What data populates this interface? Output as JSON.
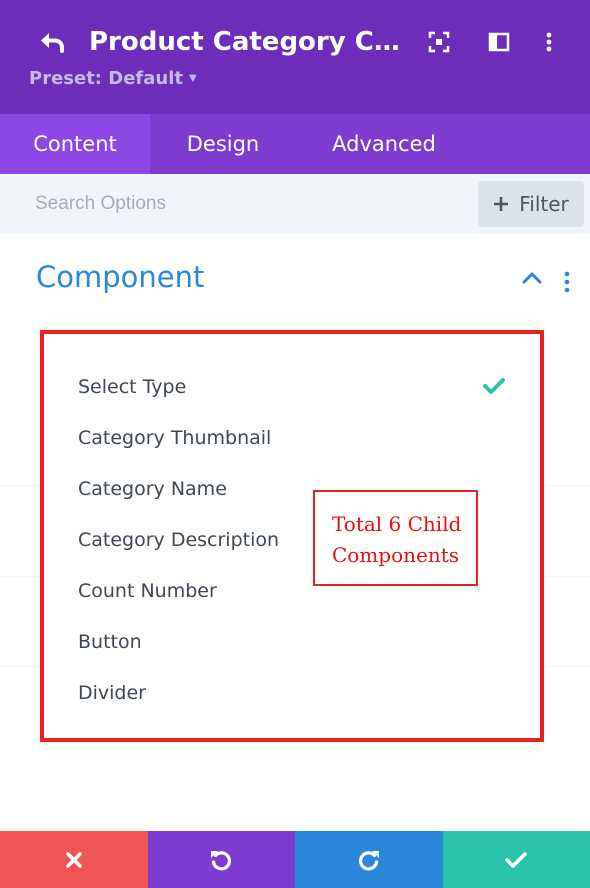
{
  "header": {
    "title": "Product Category Component",
    "preset": "Preset: Default",
    "bg_color": "#6c2eb9"
  },
  "tabs": [
    {
      "label": "Content",
      "active": true
    },
    {
      "label": "Design",
      "active": false
    },
    {
      "label": "Advanced",
      "active": false
    }
  ],
  "search": {
    "placeholder": "Search Options",
    "value": "",
    "filter_label": "Filter"
  },
  "section": {
    "title": "Component"
  },
  "dropdown": {
    "selected": "Select Type",
    "options": [
      "Select Type",
      "Category Thumbnail",
      "Category Name",
      "Category Description",
      "Count Number",
      "Button",
      "Divider"
    ]
  },
  "annotation": {
    "line1": "Total 6 Child",
    "line2": "Components",
    "color": "#e2120f"
  },
  "footer": {
    "buttons": [
      {
        "name": "discard",
        "icon": "close-icon",
        "color": "#ef5555"
      },
      {
        "name": "undo",
        "icon": "undo-icon",
        "color": "#7e3bd0"
      },
      {
        "name": "redo",
        "icon": "redo-icon",
        "color": "#2b87da"
      },
      {
        "name": "save",
        "icon": "check-icon",
        "color": "#29c4a9"
      }
    ]
  },
  "colors": {
    "accent_blue": "#2b87da",
    "check_green": "#29c4a9",
    "highlight_red": "#e8211f"
  }
}
